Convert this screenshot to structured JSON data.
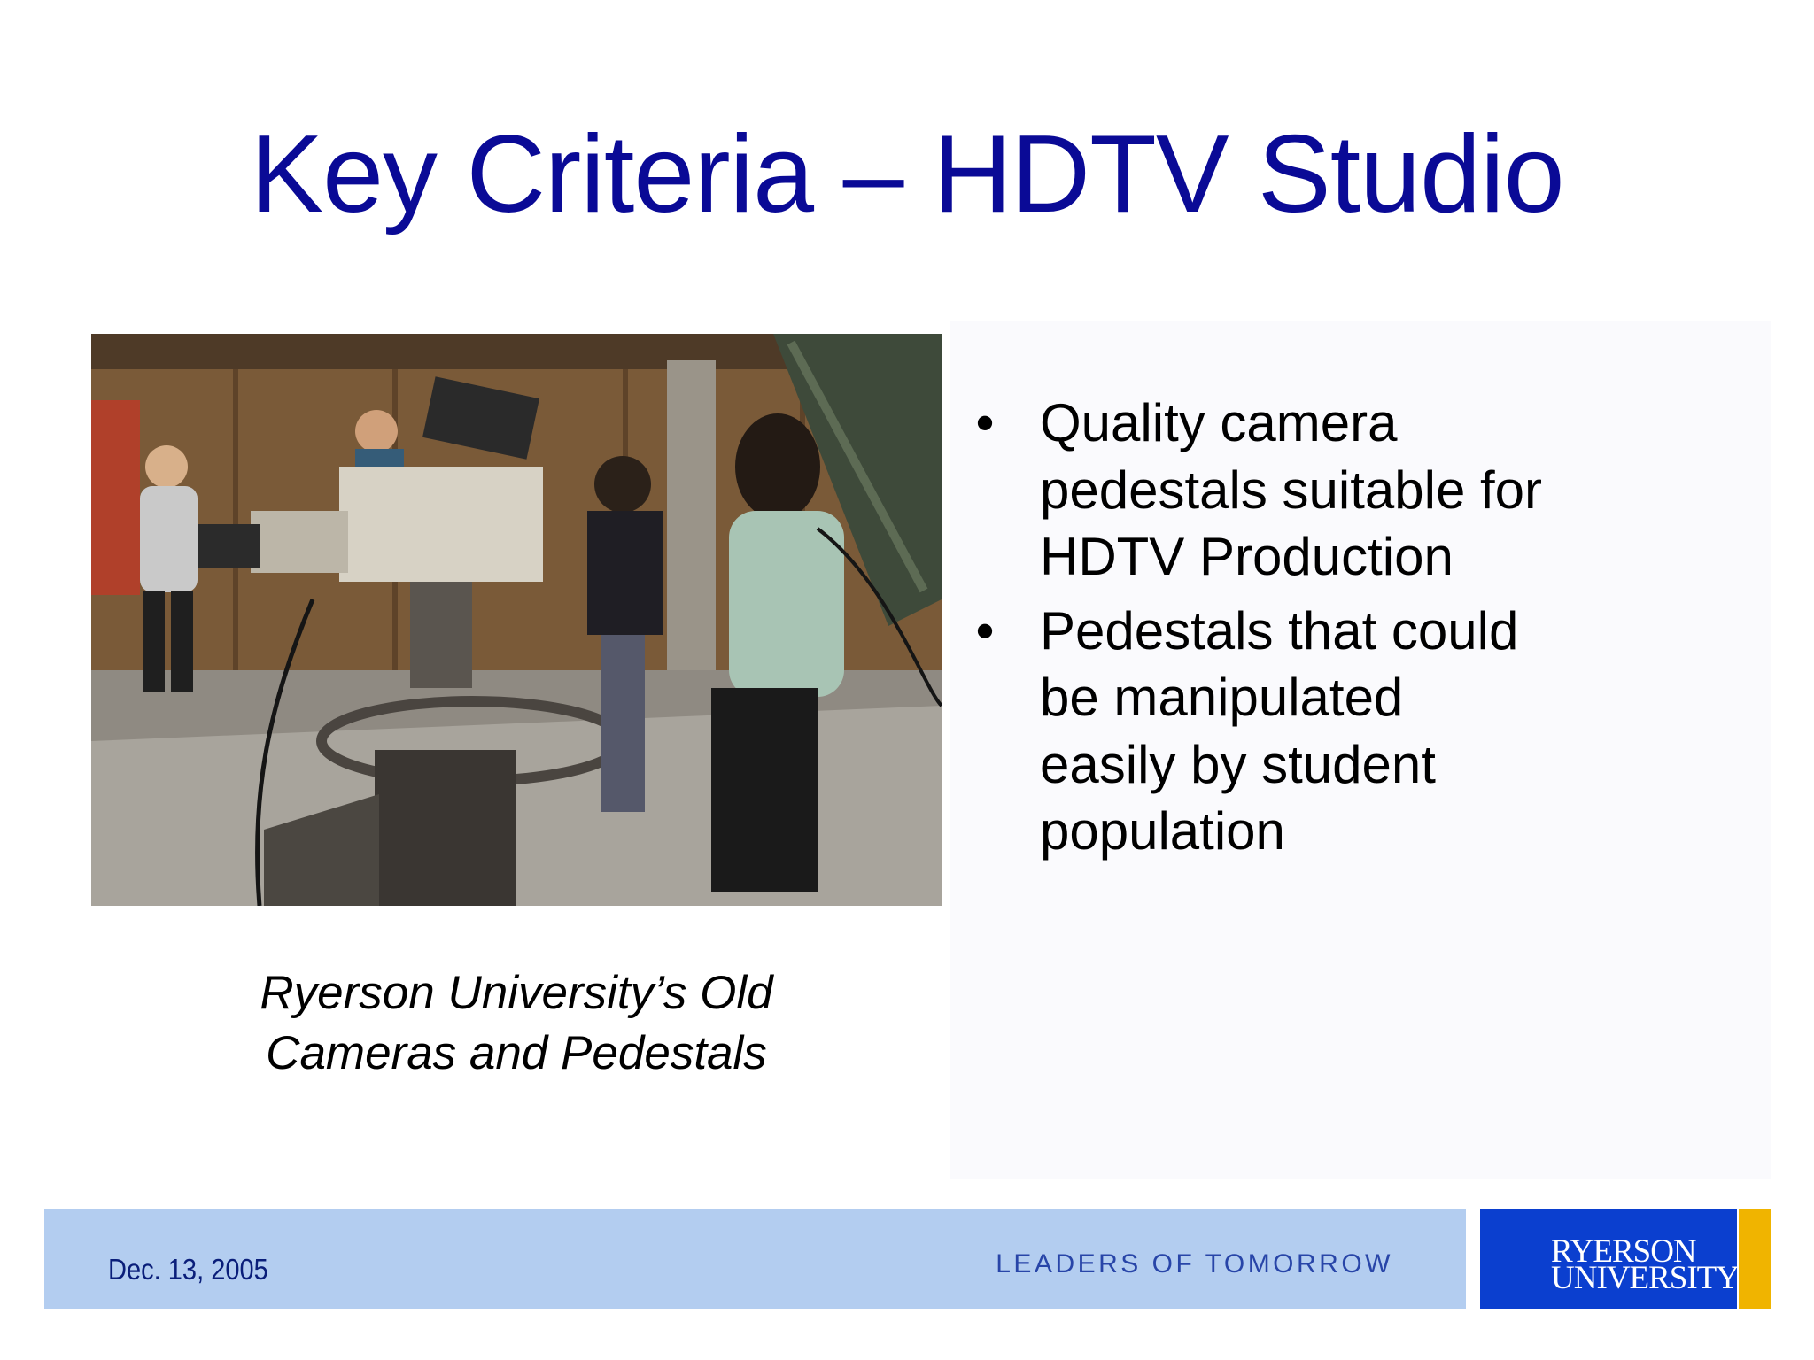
{
  "slide": {
    "title": "Key Criteria – HDTV Studio",
    "photo": {
      "alt": "Students operating old studio cameras on pedestals"
    },
    "caption": {
      "line1": "Ryerson University’s Old",
      "line2": "Cameras and Pedestals"
    },
    "bullets": [
      {
        "marker": "•",
        "lines": [
          "Quality camera",
          "pedestals suitable for",
          "HDTV Production"
        ]
      },
      {
        "marker": "•",
        "lines": [
          "Pedestals that could",
          "be manipulated",
          "easily by student",
          "population"
        ]
      }
    ]
  },
  "footer": {
    "date": "Dec. 13, 2005",
    "tagline": "LEADERS OF TOMORROW",
    "logo": {
      "line1": "RYERSON",
      "line2": "UNIVERSITY"
    }
  },
  "colors": {
    "title": "#0a0a96",
    "footer_band": "#b3cdf0",
    "logo_blue": "#0b3fcf",
    "logo_gold": "#f0b400"
  }
}
